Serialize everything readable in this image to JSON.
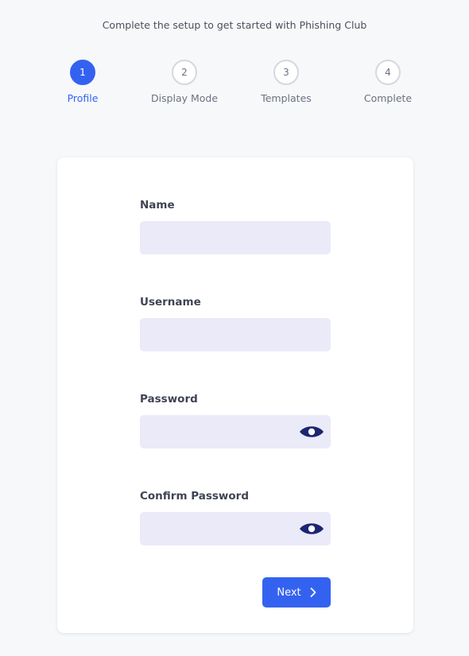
{
  "header": {
    "subtitle": "Complete the setup to get started with Phishing Club"
  },
  "steps": [
    {
      "number": "1",
      "label": "Profile",
      "active": true
    },
    {
      "number": "2",
      "label": "Display Mode",
      "active": false
    },
    {
      "number": "3",
      "label": "Templates",
      "active": false
    },
    {
      "number": "4",
      "label": "Complete",
      "active": false
    }
  ],
  "form": {
    "name": {
      "label": "Name",
      "value": ""
    },
    "username": {
      "label": "Username",
      "value": ""
    },
    "password": {
      "label": "Password",
      "value": ""
    },
    "confirm_password": {
      "label": "Confirm Password",
      "value": ""
    },
    "next_label": "Next"
  },
  "colors": {
    "accent": "#3462f0",
    "input_background": "#ebeaf8",
    "eye_icon": "#1a2670"
  },
  "icons": {
    "password_toggle": "eye-icon",
    "next": "chevron-right-icon"
  }
}
